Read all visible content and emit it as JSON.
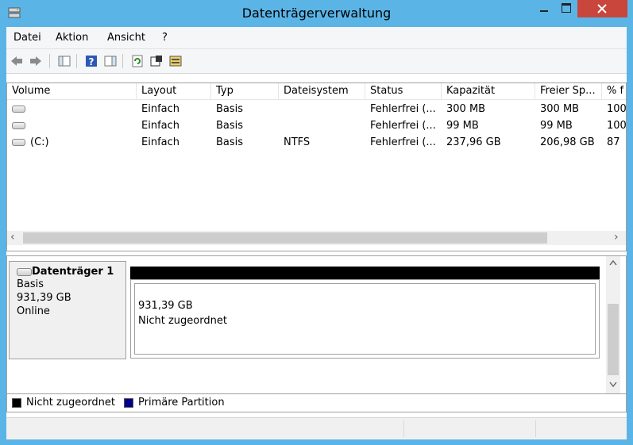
{
  "window": {
    "title": "Datenträgerverwaltung"
  },
  "menu": [
    "Datei",
    "Aktion",
    "Ansicht",
    "?"
  ],
  "toolbar": {
    "back_icon": "arrow-left-icon",
    "forward_icon": "arrow-right-icon",
    "icons": [
      "console-tree-icon",
      "help-icon",
      "action-pane-icon",
      "refresh-icon",
      "properties-icon",
      "rescan-disks-icon"
    ]
  },
  "volume_list": {
    "columns": [
      "Volume",
      "Layout",
      "Typ",
      "Dateisystem",
      "Status",
      "Kapazität",
      "Freier Sp...",
      "% f"
    ],
    "rows": [
      {
        "volume": "",
        "layout": "Einfach",
        "type": "Basis",
        "fs": "",
        "status": "Fehlerfrei (...",
        "capacity": "300 MB",
        "free": "300 MB",
        "pct": "100"
      },
      {
        "volume": "",
        "layout": "Einfach",
        "type": "Basis",
        "fs": "",
        "status": "Fehlerfrei (...",
        "capacity": "99 MB",
        "free": "99 MB",
        "pct": "100"
      },
      {
        "volume": "(C:)",
        "layout": "Einfach",
        "type": "Basis",
        "fs": "NTFS",
        "status": "Fehlerfrei (...",
        "capacity": "237,96 GB",
        "free": "206,98 GB",
        "pct": "87"
      }
    ]
  },
  "disk": {
    "name": "Datenträger 1",
    "type": "Basis",
    "size": "931,39 GB",
    "state": "Online",
    "volume": {
      "size": "931,39 GB",
      "status": "Nicht zugeordnet"
    }
  },
  "legend": [
    {
      "label": "Nicht zugeordnet",
      "color": "#000000"
    },
    {
      "label": "Primäre Partition",
      "color": "#00008b"
    }
  ],
  "colors": {
    "titlebar": "#5bb4e6",
    "close_button": "#c9463d",
    "accent": "#00008b"
  }
}
